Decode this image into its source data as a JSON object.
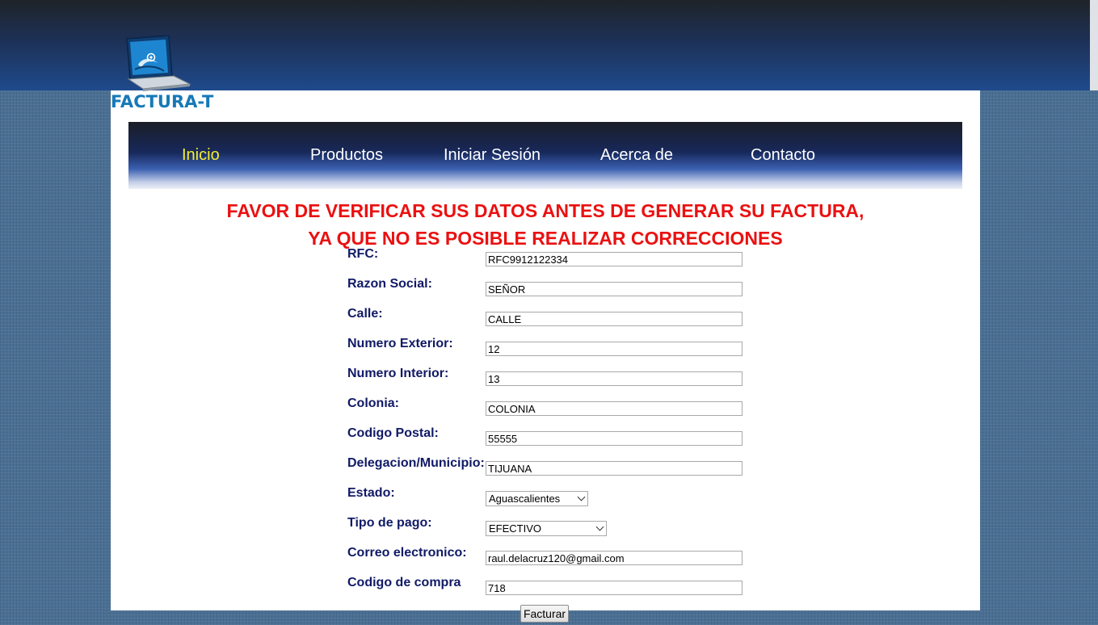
{
  "brand": {
    "logo_text": "FACTURA-T"
  },
  "nav": {
    "items": [
      {
        "label": "Inicio",
        "active": true
      },
      {
        "label": "Productos"
      },
      {
        "label": "Iniciar Sesión"
      },
      {
        "label": "Acerca de"
      },
      {
        "label": "Contacto"
      }
    ]
  },
  "warning": {
    "line1": "FAVOR DE VERIFICAR SUS DATOS ANTES DE GENERAR SU FACTURA,",
    "line2": "YA QUE NO ES POSIBLE REALIZAR CORRECCIONES"
  },
  "form": {
    "rfc": {
      "label": "RFC:",
      "value": "RFC9912122334"
    },
    "razon_social": {
      "label": "Razon Social:",
      "value": "SEÑOR"
    },
    "calle": {
      "label": "Calle:",
      "value": "CALLE"
    },
    "num_exterior": {
      "label": "Numero Exterior:",
      "value": "12"
    },
    "num_interior": {
      "label": "Numero Interior:",
      "value": "13"
    },
    "colonia": {
      "label": "Colonia:",
      "value": "COLONIA"
    },
    "codigo_postal": {
      "label": "Codigo Postal:",
      "value": "55555"
    },
    "delegacion": {
      "label": "Delegacion/Municipio:",
      "value": "TIJUANA"
    },
    "estado": {
      "label": "Estado:",
      "value": "Aguascalientes"
    },
    "tipo_pago": {
      "label": "Tipo de pago:",
      "value": "EFECTIVO"
    },
    "correo": {
      "label": "Correo electronico:",
      "value": "raul.delacruz120@gmail.com"
    },
    "codigo_compra": {
      "label": "Codigo de compra",
      "value": "718"
    },
    "submit_label": "Facturar"
  },
  "colors": {
    "warning": "#ea1111",
    "label": "#111a66",
    "nav_active": "#f4ee2f",
    "logo": "#1779b7"
  },
  "icons": [
    "laptop-logo-icon",
    "chevron-down-icon"
  ]
}
